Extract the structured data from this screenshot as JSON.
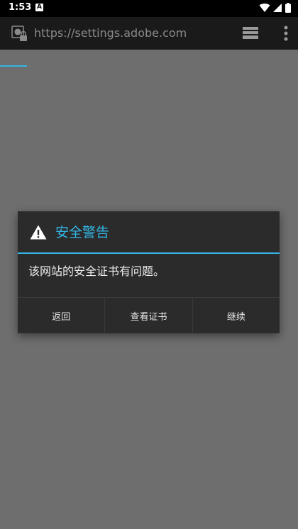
{
  "status_bar": {
    "time": "1:53",
    "notification_icon": "A",
    "icons": [
      "wifi-icon",
      "cell-signal-icon",
      "battery-icon"
    ]
  },
  "browser": {
    "url": "https://settings.adobe.com",
    "icons": [
      "site-security-icon",
      "tabs-icon",
      "overflow-menu-icon"
    ]
  },
  "dialog": {
    "title": "安全警告",
    "icon": "warning-icon",
    "message": "该网站的安全证书有问题。",
    "buttons": [
      "返回",
      "查看证书",
      "继续"
    ]
  },
  "colors": {
    "accent": "#33b5e5",
    "background_overlay": "#6e6e6e",
    "dialog_bg": "#2b2b2b",
    "toolbar_bg": "#1a1a1a"
  }
}
